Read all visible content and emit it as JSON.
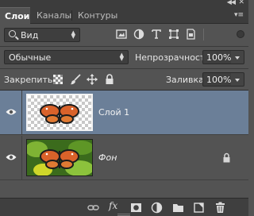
{
  "panel": {
    "tabs": [
      {
        "label": "Слои",
        "active": true
      },
      {
        "label": "Каналы",
        "active": false
      },
      {
        "label": "Контуры",
        "active": false
      }
    ]
  },
  "filter": {
    "kind_value": "Вид",
    "icons": [
      "pixel-layer-filter-icon",
      "adjustment-layer-filter-icon",
      "type-layer-filter-icon",
      "shape-layer-filter-icon",
      "smart-object-filter-icon"
    ]
  },
  "blend": {
    "mode_value": "Обычные",
    "opacity_label": "Непрозрачность:",
    "opacity_value": "100%"
  },
  "lock": {
    "label": "Закрепить:",
    "fill_label": "Заливка:",
    "fill_value": "100%",
    "icons": [
      "lock-transparent-pixels-icon",
      "lock-image-pixels-icon",
      "lock-position-icon",
      "lock-all-icon"
    ]
  },
  "layers": [
    {
      "name": "Слой 1",
      "selected": true,
      "visible": true,
      "locked": false,
      "transparent_bg": true
    },
    {
      "name": "Фон",
      "selected": false,
      "visible": true,
      "locked": true,
      "transparent_bg": false
    }
  ],
  "bottom_toolbar": {
    "icons": [
      "link-layers-icon",
      "layer-style-fx-icon",
      "add-mask-icon",
      "new-adjustment-layer-icon",
      "new-group-icon",
      "new-layer-icon",
      "delete-layer-icon"
    ],
    "fx_label": "fx"
  },
  "colors": {
    "panel_bg": "#535353",
    "tabbar_bg": "#3c3c3c",
    "selection": "#6b7f98",
    "field_bg": "#3e3e3e"
  }
}
